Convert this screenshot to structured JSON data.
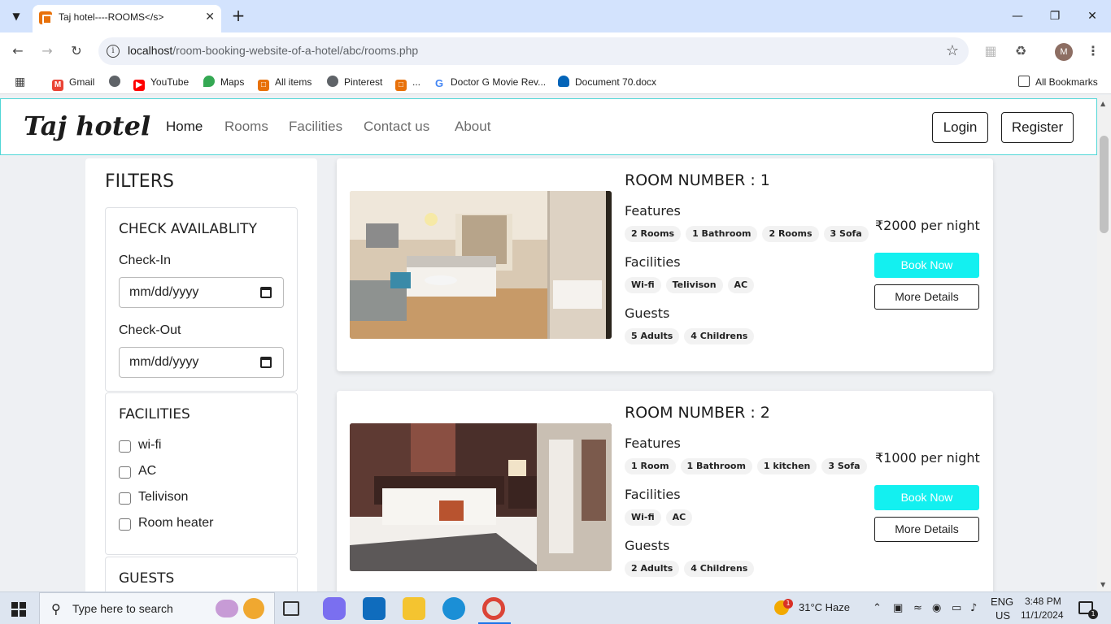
{
  "browser": {
    "tab_title": "Taj hotel----ROOMS</s>",
    "url_host": "localhost",
    "url_path": "/room-booking-website-of-a-hotel/abc/rooms.php",
    "profile_initial": "M",
    "bookmarks": [
      {
        "label": "Gmail",
        "icon": "gmail-icon",
        "color": "#ea4335"
      },
      {
        "label": "",
        "icon": "globe-icon",
        "color": "#5f6368"
      },
      {
        "label": "YouTube",
        "icon": "youtube-icon",
        "color": "#ff0000"
      },
      {
        "label": "Maps",
        "icon": "maps-icon",
        "color": "#34a853"
      },
      {
        "label": "All items",
        "icon": "xampp-icon",
        "color": "#e8710a"
      },
      {
        "label": "Pinterest",
        "icon": "globe-icon",
        "color": "#5f6368"
      },
      {
        "label": "...",
        "icon": "xampp-icon",
        "color": "#e8710a"
      },
      {
        "label": "Doctor G Movie Rev...",
        "icon": "google-icon",
        "color": "#4285f4"
      },
      {
        "label": "Document 70.docx",
        "icon": "onedrive-icon",
        "color": "#0364b8"
      }
    ],
    "all_bookmarks": "All Bookmarks"
  },
  "site": {
    "brand": "Taj hotel",
    "nav": [
      "Home",
      "Rooms",
      "Facilities",
      "Contact us",
      "About"
    ],
    "login": "Login",
    "register": "Register"
  },
  "filters": {
    "title": "FILTERS",
    "availability_title": "CHECK AVAILABLITY",
    "checkin_label": "Check-In",
    "checkout_label": "Check-Out",
    "date_placeholder": "mm/dd/yyyy",
    "facilities_title": "FACILITIES",
    "facilities": [
      "wi-fi",
      "AC",
      "Telivison",
      "Room heater"
    ],
    "guests_title": "GUESTS"
  },
  "rooms": [
    {
      "title": "ROOM NUMBER : 1",
      "features_label": "Features",
      "features": [
        "2 Rooms",
        "1 Bathroom",
        "2 Rooms",
        "3 Sofa"
      ],
      "facilities_label": "Facilities",
      "facilities": [
        "Wi-fi",
        "Telivison",
        "AC"
      ],
      "guests_label": "Guests",
      "guests": [
        "5 Adults",
        "4 Childrens"
      ],
      "price": "₹2000 per night",
      "book": "Book Now",
      "details": "More Details"
    },
    {
      "title": "ROOM NUMBER : 2",
      "features_label": "Features",
      "features": [
        "1 Room",
        "1 Bathroom",
        "1 kitchen",
        "3 Sofa"
      ],
      "facilities_label": "Facilities",
      "facilities": [
        "Wi-fi",
        "AC"
      ],
      "guests_label": "Guests",
      "guests": [
        "2 Adults",
        "4 Childrens"
      ],
      "price": "₹1000 per night",
      "book": "Book Now",
      "details": "More Details"
    }
  ],
  "taskbar": {
    "search_placeholder": "Type here to search",
    "weather": "31°C  Haze",
    "weather_badge": "1",
    "lang_1": "ENG",
    "lang_2": "US",
    "time": "3:48 PM",
    "date": "11/1/2024",
    "notification_count": "1"
  },
  "colors": {
    "accent": "#13f0f0",
    "nav_border": "#4fd6d6",
    "tabstrip": "#d3e3fd"
  }
}
